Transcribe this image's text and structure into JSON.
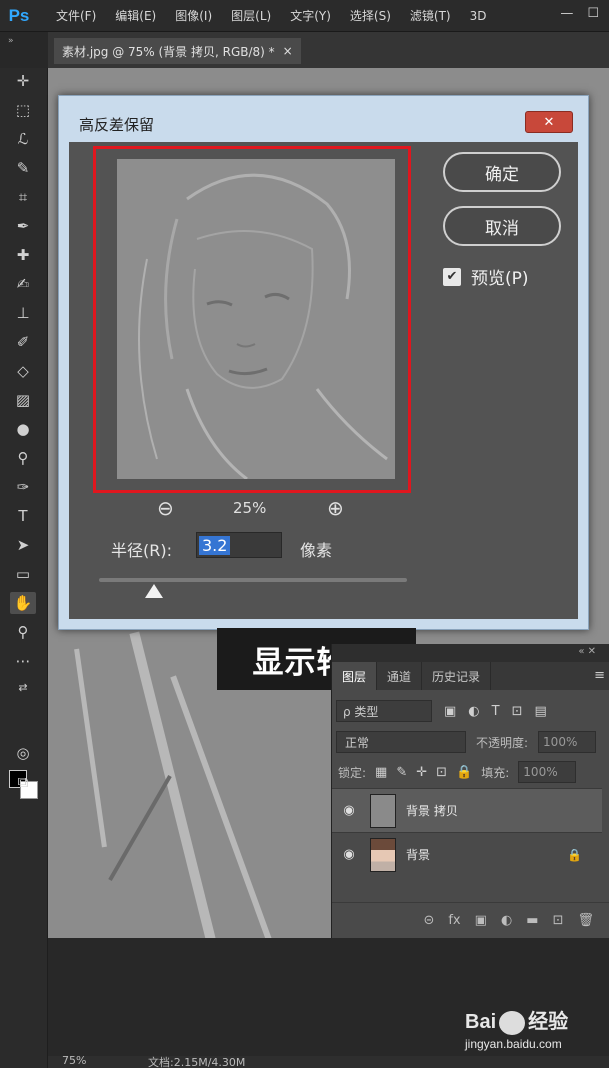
{
  "app": {
    "logo": "Ps"
  },
  "menu": [
    "文件(F)",
    "编辑(E)",
    "图像(I)",
    "图层(L)",
    "文字(Y)",
    "选择(S)",
    "滤镜(T)",
    "3D"
  ],
  "window_controls": [
    "—",
    "☐"
  ],
  "document_tab": {
    "title": "素材.jpg @ 75% (背景 拷贝, RGB/8) *",
    "close": "×"
  },
  "dialog": {
    "title": "高反差保留",
    "close": "✕",
    "zoom_out": "⊖",
    "zoom_level": "25%",
    "zoom_in": "⊕",
    "radius_label": "半径(R):",
    "radius_value": "3.2",
    "radius_unit": "像素",
    "ok_button": "确定",
    "cancel_button": "取消",
    "preview_checkbox": {
      "label": "预览(P)",
      "checked": true,
      "mark": "✔"
    },
    "slider_position": 0.18
  },
  "caption": "显示轮廓",
  "layers_panel": {
    "tabs": [
      "图层",
      "通道",
      "历史记录"
    ],
    "menu_icon": "≡",
    "filter_kind": "ρ 类型",
    "filter_icons": [
      "▣",
      "◐",
      "T",
      "⊡",
      "▤"
    ],
    "blend_mode": "正常",
    "opacity_label": "不透明度:",
    "opacity_value": "100%",
    "lock_label": "锁定:",
    "lock_icons": [
      "▦",
      "✎",
      "✛",
      "⊡",
      "🔒"
    ],
    "fill_label": "填充:",
    "fill_value": "100%",
    "layers": [
      {
        "name": "背景 拷贝",
        "visible_icon": "◉",
        "selected": true,
        "locked": false
      },
      {
        "name": "背景",
        "visible_icon": "◉",
        "selected": false,
        "locked": true
      }
    ],
    "bottom_icons": [
      "⊝",
      "fx",
      "▣",
      "◐",
      "▬",
      "⊡",
      "🗑"
    ]
  },
  "status_bar": {
    "zoom": "75%",
    "doc": "文档:2.15M/4.30M"
  },
  "watermark": {
    "main_left": "Bai",
    "main_right": "经验",
    "sub": "jingyan.baidu.com"
  },
  "colors": {
    "accent_red": "#e0161e",
    "ps_blue": "#31a8ff",
    "selection_blue": "#3575d3"
  }
}
